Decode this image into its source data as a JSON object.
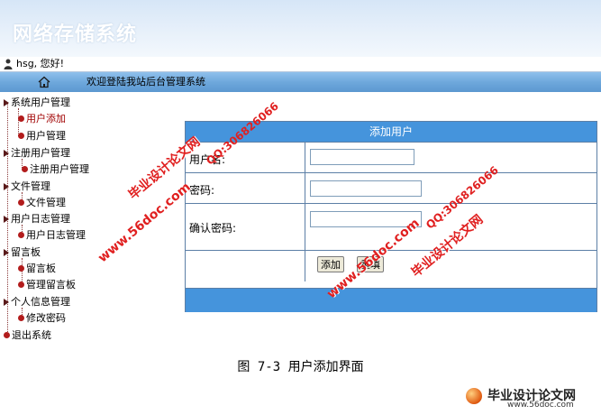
{
  "header": {
    "app_title": "网络存储系统"
  },
  "userbar": {
    "greeting": "hsg, 您好!"
  },
  "navbar": {
    "welcome": "欢迎登陆我站后台管理系统"
  },
  "sidebar": {
    "groups": [
      {
        "label": "系统用户管理",
        "items": [
          {
            "label": "用户添加",
            "active": true
          },
          {
            "label": "用户管理"
          }
        ]
      },
      {
        "label": "注册用户管理",
        "items": [
          {
            "label": "注册用户管理"
          }
        ]
      },
      {
        "label": "文件管理",
        "items": [
          {
            "label": "文件管理"
          }
        ]
      },
      {
        "label": "用户日志管理",
        "items": [
          {
            "label": "用户日志管理"
          }
        ]
      },
      {
        "label": "留言板",
        "items": [
          {
            "label": "留言板"
          },
          {
            "label": "管理留言板"
          }
        ]
      },
      {
        "label": "个人信息管理",
        "items": [
          {
            "label": "修改密码"
          }
        ]
      }
    ],
    "logout": "退出系统"
  },
  "form": {
    "title": "添加用户",
    "username_label": "用户名:",
    "password_label": "密码:",
    "confirm_label": "确认密码:",
    "username_value": "",
    "password_value": "",
    "confirm_value": "",
    "add_button": "添加",
    "reset_button": "重填"
  },
  "caption": "图 7-3 用户添加界面",
  "watermarks": {
    "site_name": "毕业设计论文网",
    "url": "www.56doc.com",
    "qq": "QQ:306826066",
    "corner_title": "毕业设计论文网",
    "corner_url": "www.56doc.com"
  },
  "colors": {
    "form_header": "#4594dc",
    "navbar": "#6ea8dc",
    "active_item": "#a00000",
    "watermark": "#e02020"
  },
  "icons": {
    "user": "user-icon",
    "home": "home-icon"
  }
}
